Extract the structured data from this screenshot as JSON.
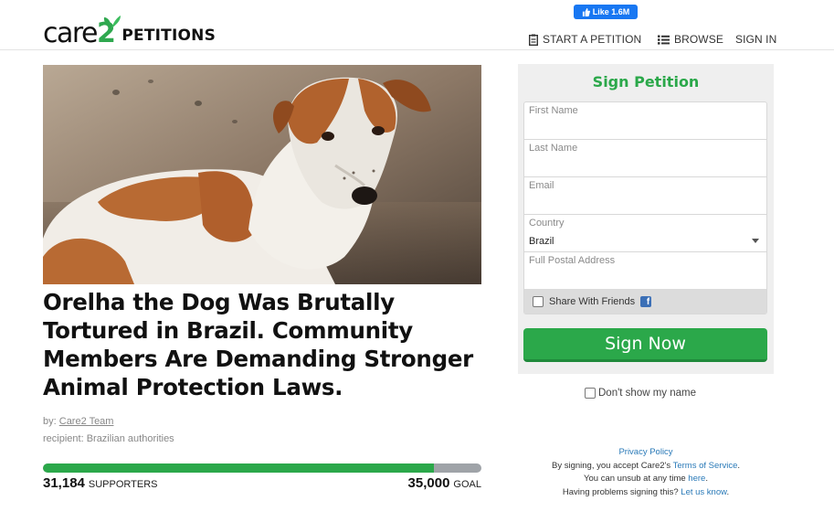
{
  "header": {
    "logo_word": "care",
    "logo_two": "2",
    "logo_section": "PETITIONS",
    "fb_like": "Like 1.6M",
    "nav": {
      "start_petition": "START A PETITION",
      "browse": "BROWSE",
      "sign_in": "SIGN IN"
    }
  },
  "petition": {
    "title": "Orelha the Dog Was Brutally Tortured in Brazil. Community Members Are Demanding Stronger Animal Protection Laws.",
    "by_label": "by:",
    "author": "Care2 Team",
    "recipient": "recipient: Brazilian authorities",
    "supporters_count": "31,184",
    "supporters_label": "SUPPORTERS",
    "goal_count": "35,000",
    "goal_label": "GOAL",
    "progress_fraction": 0.891
  },
  "sign_form": {
    "title": "Sign Petition",
    "first_name_label": "First Name",
    "last_name_label": "Last Name",
    "email_label": "Email",
    "country_label": "Country",
    "country_value": "Brazil",
    "address_label": "Full Postal Address",
    "share_label": "Share With Friends",
    "submit_label": "Sign Now",
    "dont_show_label": "Don't show my name"
  },
  "legal": {
    "privacy": "Privacy Policy",
    "accept_prefix": "By signing, you accept Care2's ",
    "terms": "Terms of Service",
    "accept_suffix": ".",
    "unsub_prefix": "You can unsub at any time ",
    "unsub_link": "here",
    "unsub_suffix": ".",
    "problems_prefix": "Having problems signing this? ",
    "problems_link": "Let us know",
    "problems_suffix": "."
  },
  "colors": {
    "brand_green": "#2ba84a",
    "progress_track": "#9fa3a8",
    "link_blue": "#2a7ab8",
    "facebook_blue": "#1877f2"
  }
}
